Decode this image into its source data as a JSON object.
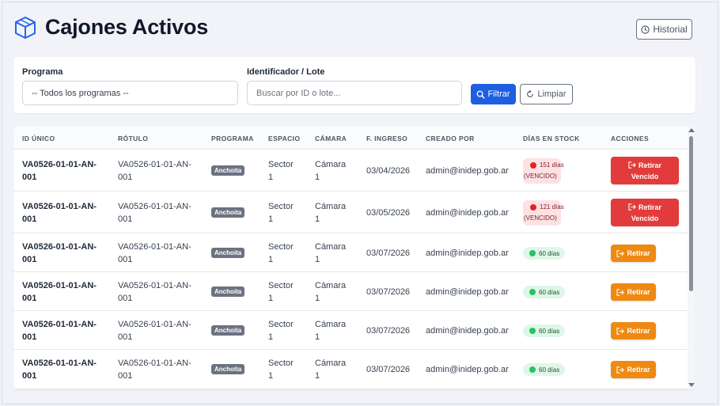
{
  "header": {
    "title": "Cajones Activos",
    "history_label": "Historial"
  },
  "filters": {
    "program_label": "Programa",
    "program_selected": "-- Todos los programas --",
    "id_label": "Identificador / Lote",
    "search_placeholder": "Buscar por ID o lote...",
    "filter_label": "Filtrar",
    "clear_label": "Limpiar"
  },
  "table": {
    "columns": [
      "ID ÚNICO",
      "RÓTULO",
      "PROGRAMA",
      "ESPACIO",
      "CÁMARA",
      "F. INGRESO",
      "CREADO POR",
      "DÍAS EN STOCK",
      "ACCIONES"
    ],
    "rows": [
      {
        "id_line1": "VA0526-01-01-AN-",
        "id_line2": "001",
        "rotulo_line1": "VA0526-01-01-AN-",
        "rotulo_line2": "001",
        "programa": "Anchoita",
        "espacio_line1": "Sector",
        "espacio_line2": "1",
        "camara_line1": "Cámara",
        "camara_line2": "1",
        "ingreso": "03/04/2026",
        "creado_por": "admin@inidep.gob.ar",
        "dias_line1": "151 días",
        "dias_line2": "(VENCIDO)",
        "status": "vencido",
        "action_line1": "Retirar",
        "action_line2": "Vencido"
      },
      {
        "id_line1": "VA0526-01-01-AN-",
        "id_line2": "001",
        "rotulo_line1": "VA0526-01-01-AN-",
        "rotulo_line2": "001",
        "programa": "Anchoita",
        "espacio_line1": "Sector",
        "espacio_line2": "1",
        "camara_line1": "Cámara",
        "camara_line2": "1",
        "ingreso": "03/05/2026",
        "creado_por": "admin@inidep.gob.ar",
        "dias_line1": "121 días",
        "dias_line2": "(VENCIDO)",
        "status": "vencido",
        "action_line1": "Retirar",
        "action_line2": "Vencido"
      },
      {
        "id_line1": "VA0526-01-01-AN-",
        "id_line2": "001",
        "rotulo_line1": "VA0526-01-01-AN-",
        "rotulo_line2": "001",
        "programa": "Anchoita",
        "espacio_line1": "Sector",
        "espacio_line2": "1",
        "camara_line1": "Cámara",
        "camara_line2": "1",
        "ingreso": "03/07/2026",
        "creado_por": "admin@inidep.gob.ar",
        "dias_line1": "60 días",
        "dias_line2": "",
        "status": "ok",
        "action_line1": "Retirar",
        "action_line2": ""
      },
      {
        "id_line1": "VA0526-01-01-AN-",
        "id_line2": "001",
        "rotulo_line1": "VA0526-01-01-AN-",
        "rotulo_line2": "001",
        "programa": "Anchoita",
        "espacio_line1": "Sector",
        "espacio_line2": "1",
        "camara_line1": "Cámara",
        "camara_line2": "1",
        "ingreso": "03/07/2026",
        "creado_por": "admin@inidep.gob.ar",
        "dias_line1": "60 días",
        "dias_line2": "",
        "status": "ok",
        "action_line1": "Retirar",
        "action_line2": ""
      },
      {
        "id_line1": "VA0526-01-01-AN-",
        "id_line2": "001",
        "rotulo_line1": "VA0526-01-01-AN-",
        "rotulo_line2": "001",
        "programa": "Anchoita",
        "espacio_line1": "Sector",
        "espacio_line2": "1",
        "camara_line1": "Cámara",
        "camara_line2": "1",
        "ingreso": "03/07/2026",
        "creado_por": "admin@inidep.gob.ar",
        "dias_line1": "60 días",
        "dias_line2": "",
        "status": "ok",
        "action_line1": "Retirar",
        "action_line2": ""
      },
      {
        "id_line1": "VA0526-01-01-AN-",
        "id_line2": "001",
        "rotulo_line1": "VA0526-01-01-AN-",
        "rotulo_line2": "001",
        "programa": "Anchoita",
        "espacio_line1": "Sector",
        "espacio_line2": "1",
        "camara_line1": "Cámara",
        "camara_line2": "1",
        "ingreso": "03/07/2026",
        "creado_por": "admin@inidep.gob.ar",
        "dias_line1": "60 días",
        "dias_line2": "",
        "status": "ok",
        "action_line1": "Retirar",
        "action_line2": ""
      }
    ]
  },
  "colors": {
    "primary": "#1d5fe0",
    "danger": "#e23b3b",
    "warning": "#ee8a12",
    "badge_gray": "#6b7280"
  },
  "icons": {
    "title": "box-icon",
    "history": "clock-icon",
    "filter": "search-icon",
    "clear": "refresh-icon",
    "action": "sign-out-icon"
  }
}
